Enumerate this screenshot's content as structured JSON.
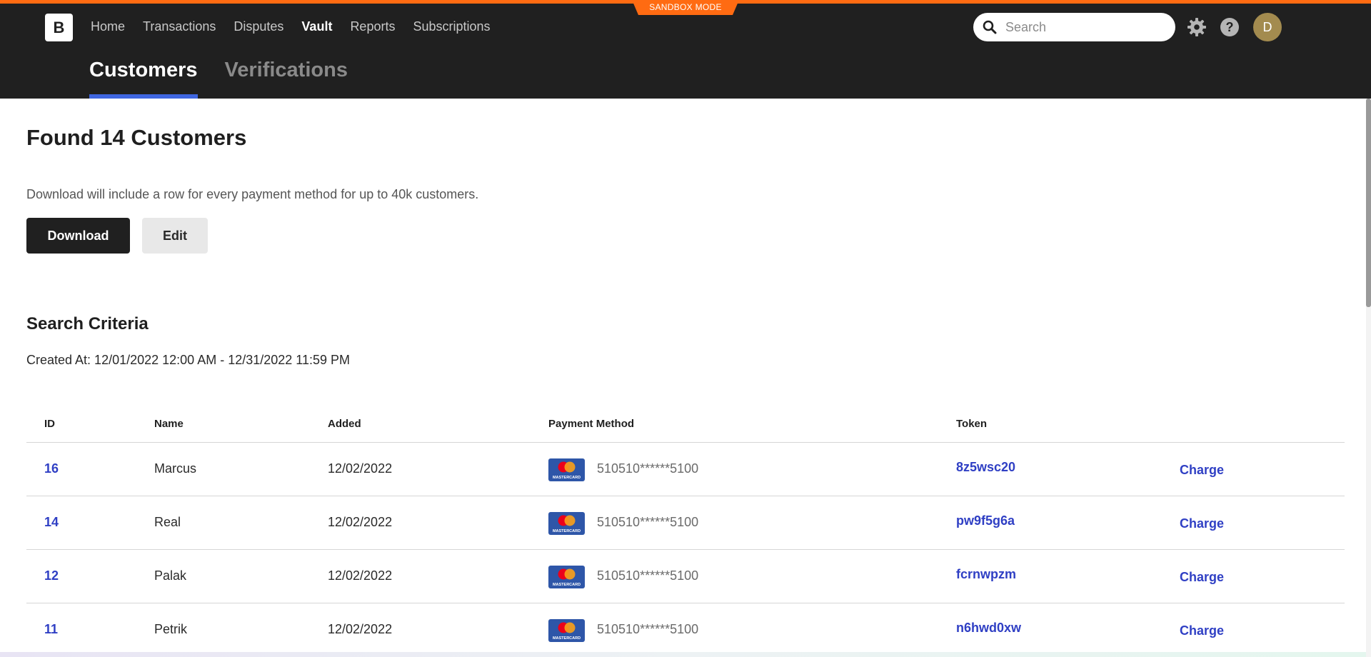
{
  "header": {
    "sandbox_label": "SANDBOX MODE",
    "logo_letter": "B",
    "nav": [
      {
        "label": "Home",
        "active": false
      },
      {
        "label": "Transactions",
        "active": false
      },
      {
        "label": "Disputes",
        "active": false
      },
      {
        "label": "Vault",
        "active": true
      },
      {
        "label": "Reports",
        "active": false
      },
      {
        "label": "Subscriptions",
        "active": false
      }
    ],
    "search_placeholder": "Search",
    "avatar_initial": "D",
    "subtabs": [
      {
        "label": "Customers",
        "active": true
      },
      {
        "label": "Verifications",
        "active": false
      }
    ]
  },
  "main": {
    "title": "Found 14 Customers",
    "download_note": "Download will include a row for every payment method for up to 40k customers.",
    "download_button": "Download",
    "edit_button": "Edit",
    "criteria_title": "Search Criteria",
    "criteria_line": "Created At: 12/01/2022 12:00 AM - 12/31/2022 11:59 PM"
  },
  "table": {
    "headers": {
      "id": "ID",
      "name": "Name",
      "added": "Added",
      "payment_method": "Payment Method",
      "token": "Token"
    },
    "rows": [
      {
        "id": "16",
        "name": "Marcus",
        "added": "12/02/2022",
        "card_brand": "MASTERCARD",
        "pan": "510510******5100",
        "token": "8z5wsc20",
        "action": "Charge"
      },
      {
        "id": "14",
        "name": "Real",
        "added": "12/02/2022",
        "card_brand": "MASTERCARD",
        "pan": "510510******5100",
        "token": "pw9f5g6a",
        "action": "Charge"
      },
      {
        "id": "12",
        "name": "Palak",
        "added": "12/02/2022",
        "card_brand": "MASTERCARD",
        "pan": "510510******5100",
        "token": "fcrnwpzm",
        "action": "Charge"
      },
      {
        "id": "11",
        "name": "Petrik",
        "added": "12/02/2022",
        "card_brand": "MASTERCARD",
        "pan": "510510******5100",
        "token": "n6hwd0xw",
        "action": "Charge"
      }
    ]
  },
  "icons": {
    "search": "search-icon",
    "settings": "gear-icon",
    "help": "help-icon",
    "card": "mastercard-icon"
  },
  "colors": {
    "header_bg": "#202020",
    "accent_orange": "#ff6b12",
    "tab_underline": "#3f66e0",
    "link_blue": "#2f3fc4",
    "avatar_bg": "#a38b4f"
  }
}
